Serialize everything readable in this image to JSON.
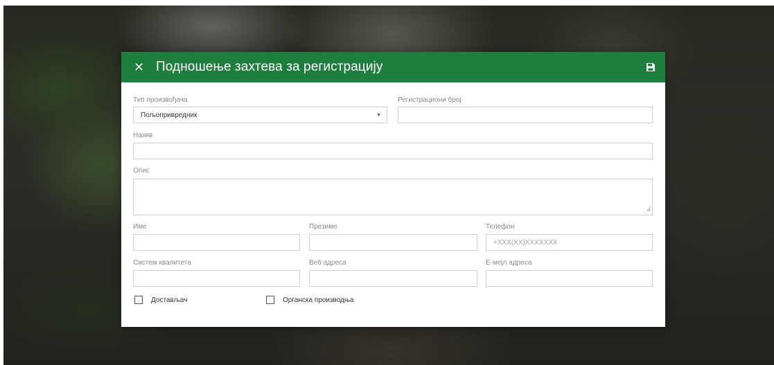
{
  "modal": {
    "title": "Подношење захтева за регистрацију",
    "close_icon": "close-icon",
    "save_icon": "floppy-disk-icon",
    "header_color": "#1e7e3e"
  },
  "form": {
    "producer_type": {
      "label": "Тип произвођача",
      "value": "Пољопривредник"
    },
    "registration_number": {
      "label": "Регистрациони број",
      "value": ""
    },
    "name": {
      "label": "Назив",
      "value": ""
    },
    "description": {
      "label": "Опис",
      "value": ""
    },
    "first_name": {
      "label": "Име",
      "value": ""
    },
    "last_name": {
      "label": "Презиме",
      "value": ""
    },
    "phone": {
      "label": "Телефон",
      "placeholder": "+XXX(XX)XXXXXXX"
    },
    "quality_system": {
      "label": "Систем квалитета",
      "value": ""
    },
    "website": {
      "label": "Веб адреса",
      "value": ""
    },
    "email": {
      "label": "Е-мејл адреса",
      "value": ""
    },
    "delivery": {
      "label": "Достављач",
      "checked": false
    },
    "organic": {
      "label": "Органска производња",
      "checked": false
    }
  }
}
